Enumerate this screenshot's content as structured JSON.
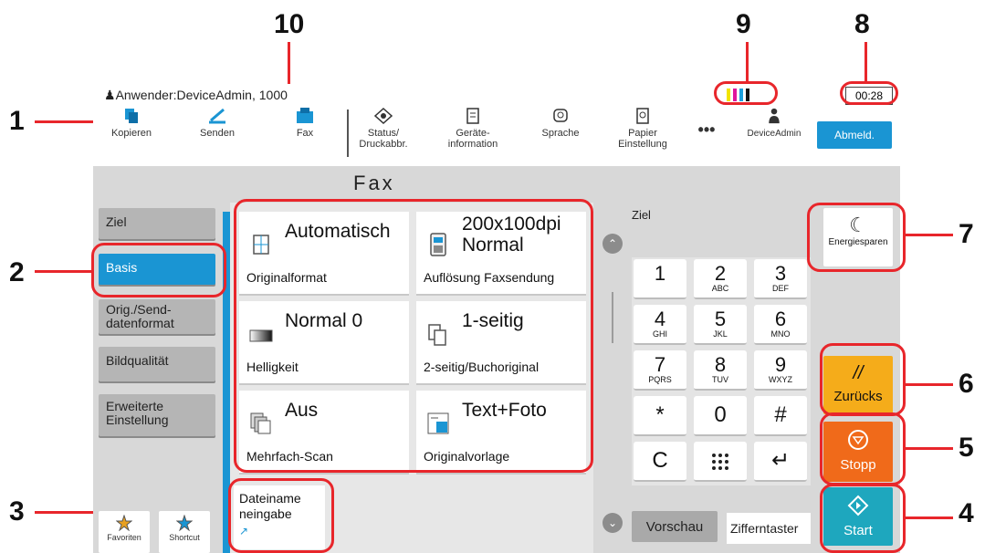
{
  "callouts": [
    "1",
    "2",
    "3",
    "4",
    "5",
    "6",
    "7",
    "8",
    "9",
    "10"
  ],
  "header": {
    "user_line": "Anwender:DeviceAdmin, 1000",
    "clock": "00:28",
    "toner_colors": [
      "#f2e500",
      "#e0169c",
      "#1a9fdc",
      "#111111"
    ]
  },
  "toolbar": {
    "items": [
      {
        "label": "Kopieren",
        "icon": "copy-icon"
      },
      {
        "label": "Senden",
        "icon": "send-icon"
      },
      {
        "label": "Fax",
        "icon": "fax-icon"
      },
      {
        "label": "Status/\nDruckabbr.",
        "icon": "status-icon"
      },
      {
        "label": "Geräte-\ninformation",
        "icon": "device-info-icon"
      },
      {
        "label": "Sprache",
        "icon": "language-icon"
      },
      {
        "label": "Papier\nEinstellung",
        "icon": "paper-icon"
      },
      {
        "label": "•••",
        "icon": "more-icon"
      },
      {
        "label": "DeviceAdmin",
        "icon": "user-icon"
      }
    ],
    "logout_label": "Abmeld."
  },
  "main": {
    "title": "Fax",
    "side_tabs": [
      {
        "label": "Ziel"
      },
      {
        "label": "Basis"
      },
      {
        "label": "Orig./Send-\ndatenformat"
      },
      {
        "label": "Bildqualität"
      },
      {
        "label": "Erweiterte\nEinstellung"
      }
    ],
    "cards": [
      {
        "value": "Automatisch",
        "label": "Originalformat",
        "icon": "original-format-icon"
      },
      {
        "value": "200x100dpi\nNormal",
        "label": "Auflösung Faxsendung",
        "icon": "resolution-icon"
      },
      {
        "value": "Normal 0",
        "label": "Helligkeit",
        "icon": "brightness-icon"
      },
      {
        "value": "1-seitig",
        "label": "2-seitig/Buchoriginal",
        "icon": "duplex-icon"
      },
      {
        "value": "Aus",
        "label": "Mehrfach-Scan",
        "icon": "multi-scan-icon"
      },
      {
        "value": "Text+Foto",
        "label": "Originalvorlage",
        "icon": "original-type-icon"
      }
    ],
    "filename_label": "Dateiname\nneingabe",
    "favorites_label": "Favoriten",
    "shortcut_label": "Shortcut"
  },
  "right": {
    "ziel_label": "Ziel",
    "keys": [
      {
        "d": "1",
        "s": ""
      },
      {
        "d": "2",
        "s": "ABC"
      },
      {
        "d": "3",
        "s": "DEF"
      },
      {
        "d": "4",
        "s": "GHI"
      },
      {
        "d": "5",
        "s": "JKL"
      },
      {
        "d": "6",
        "s": "MNO"
      },
      {
        "d": "7",
        "s": "PQRS"
      },
      {
        "d": "8",
        "s": "TUV"
      },
      {
        "d": "9",
        "s": "WXYZ"
      },
      {
        "d": "*",
        "s": ""
      },
      {
        "d": "0",
        "s": ""
      },
      {
        "d": "#",
        "s": ""
      }
    ],
    "clear_key": "C",
    "enter_key": "↵",
    "preview_label": "Vorschau",
    "keypad_label": "Zifferntaster",
    "energy_label": "Energiesparen",
    "reset_label": "Zurücks",
    "stop_label": "Stopp",
    "start_label": "Start"
  }
}
